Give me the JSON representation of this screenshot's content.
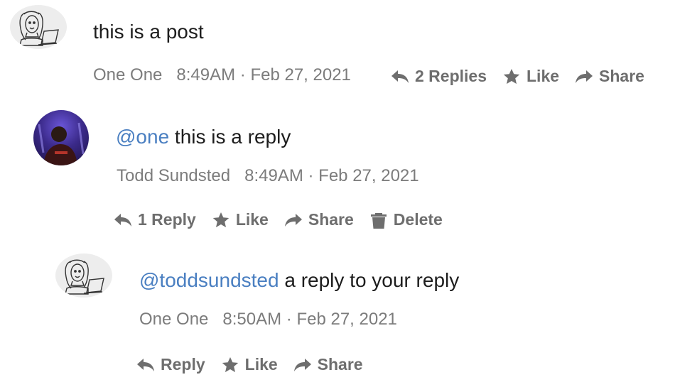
{
  "post": {
    "avatar_icon": "sketch-person-laptop-avatar",
    "text": "this is a post",
    "author": "One One",
    "timestamp": "8:49AM · Feb 27, 2021",
    "actions": {
      "replies": "2 Replies",
      "like": "Like",
      "share": "Share"
    }
  },
  "reply1": {
    "avatar_icon": "photo-avatar",
    "mention": "@one",
    "text": "this is a reply",
    "author": "Todd Sundsted",
    "timestamp": "8:49AM · Feb 27, 2021",
    "actions": {
      "replies": "1 Reply",
      "like": "Like",
      "share": "Share",
      "delete": "Delete"
    }
  },
  "reply2": {
    "avatar_icon": "sketch-person-laptop-avatar",
    "mention": "@toddsundsted",
    "text": "a reply to your reply",
    "author": "One One",
    "timestamp": "8:50AM · Feb 27, 2021",
    "actions": {
      "reply": "Reply",
      "like": "Like",
      "share": "Share"
    }
  },
  "colors": {
    "mention": "#4a7fc1",
    "meta": "#7c7c7c",
    "actions": "#6e6e6e",
    "text": "#1d1d1d"
  }
}
